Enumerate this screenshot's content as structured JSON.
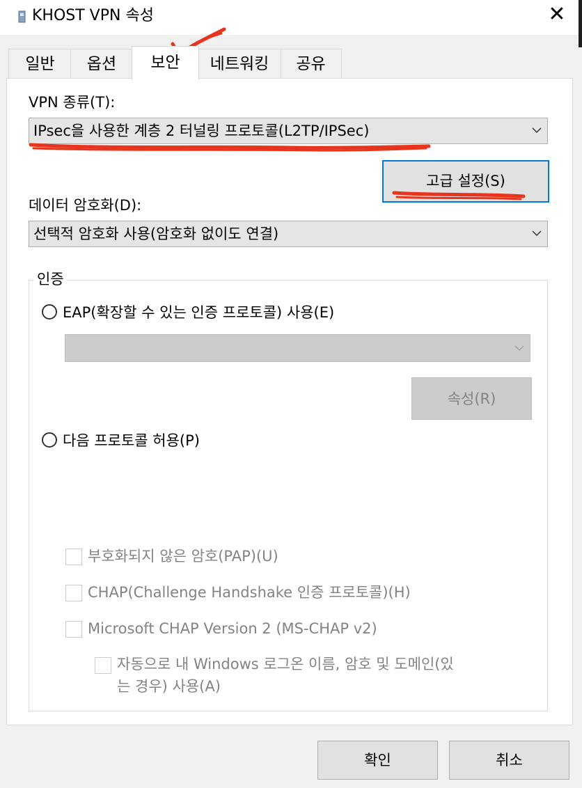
{
  "window": {
    "title": "KHOST VPN 속성",
    "close_label": "✕"
  },
  "tabs": [
    {
      "label": "일반",
      "active": false
    },
    {
      "label": "옵션",
      "active": false
    },
    {
      "label": "보안",
      "active": true
    },
    {
      "label": "네트워킹",
      "active": false
    },
    {
      "label": "공유",
      "active": false
    }
  ],
  "security": {
    "vpn_type_label": "VPN 종류(T):",
    "vpn_type_value": "IPsec을 사용한 계층 2 터널링 프로토콜(L2TP/IPSec)",
    "advanced_button": "고급 설정(S)",
    "encryption_label": "데이터 암호화(D):",
    "encryption_value": "선택적 암호화 사용(암호화 없이도 연결)",
    "auth": {
      "legend": "인증",
      "eap_radio": "EAP(확장할 수 있는 인증 프로토콜) 사용(E)",
      "eap_select_value": "",
      "properties_button": "속성(R)",
      "allow_radio": "다음 프로토콜 허용(P)",
      "protocols": [
        {
          "label": "부호화되지 않은 암호(PAP)(U)",
          "checked": false
        },
        {
          "label": "CHAP(Challenge Handshake 인증 프로토콜)(H)",
          "checked": false
        },
        {
          "label": "Microsoft CHAP Version 2 (MS-CHAP v2)",
          "checked": false
        }
      ],
      "auto_logon_line1": "자동으로 내 Windows 로그온 이름, 암호 및 도메인(있",
      "auto_logon_line2": "는 경우) 사용(A)"
    }
  },
  "footer": {
    "ok": "확인",
    "cancel": "취소"
  },
  "colors": {
    "annotation_red": "#e8341c",
    "focus_blue": "#0078d7"
  }
}
